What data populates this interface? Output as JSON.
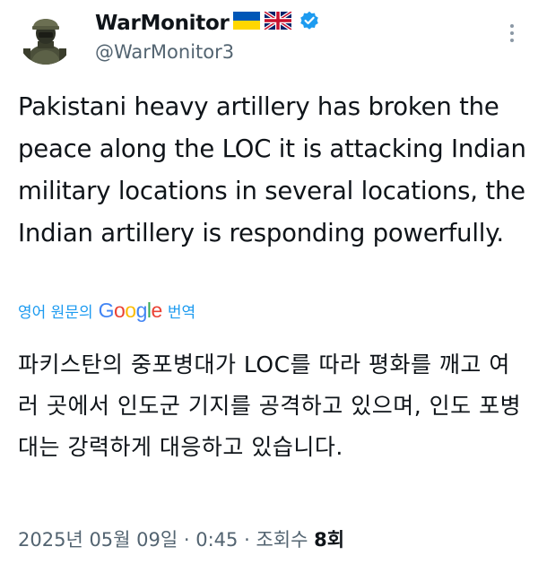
{
  "author": {
    "name": "WarMonitor",
    "handle": "@WarMonitor3",
    "flags": [
      "ukraine-flag-icon",
      "uk-flag-icon"
    ],
    "verified": true
  },
  "tweet": {
    "text": "Pakistani heavy artillery has broken the peace along the LOC it is attacking Indian military locations in several locations, the Indian artillery is responding powerfully."
  },
  "translation": {
    "prefix": "영어 원문의",
    "provider_letters": [
      "G",
      "o",
      "o",
      "g",
      "l",
      "e"
    ],
    "suffix": "번역",
    "text": "파키스탄의 중포병대가 LOC를 따라 평화를 깨고 여러 곳에서 인도군 기지를 공격하고 있으며, 인도 포병대는 강력하게 대응하고 있습니다."
  },
  "meta": {
    "date": "2025년 05월 09일",
    "time": "0:45",
    "views_label": "조회수",
    "views_count": "8회"
  },
  "colors": {
    "accent": "#1d9bf0",
    "secondary_text": "#536471",
    "primary_text": "#0f1419"
  }
}
